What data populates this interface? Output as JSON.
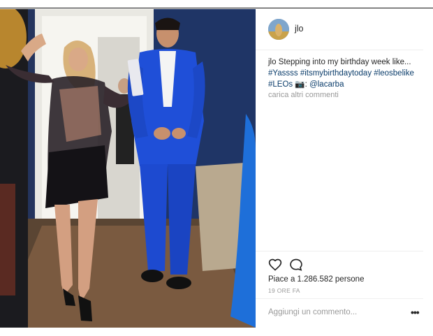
{
  "post": {
    "username": "jlo",
    "caption": {
      "user": "jlo",
      "text": " Stepping into my birthday week like... ",
      "tag1": "#Yassss",
      "tag2": "#itsmybirthdaytoday",
      "tag3": "#leosbelike",
      "tag4": "#LEOs",
      "camera": " 📷: ",
      "mention": "@lacarba"
    },
    "load_more": "carica altri commenti",
    "likes": "Piace a 1.286.582 persone",
    "time": "19 ORE FA",
    "comment_placeholder": "Aggiungi un commento...",
    "more_dots": "•••"
  },
  "colors": {
    "link": "#0b3d6b",
    "text": "#262626",
    "muted": "#999999",
    "suit": "#1f4fd8"
  },
  "icons": {
    "like": "heart-outline-icon",
    "comment": "comment-bubble-icon",
    "more": "more-options-icon"
  }
}
